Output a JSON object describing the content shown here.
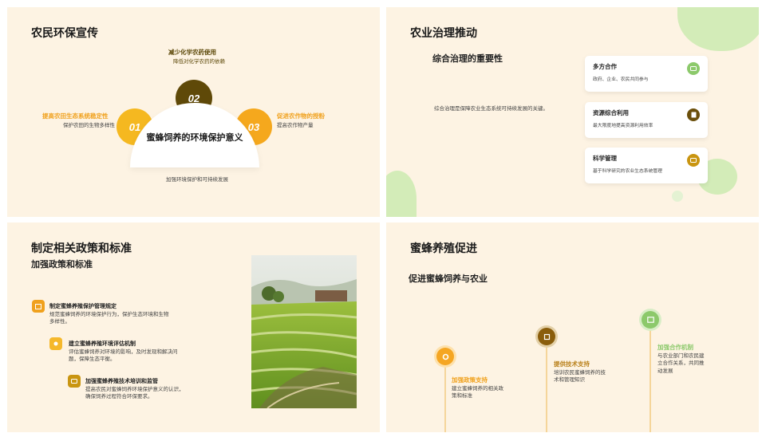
{
  "slide1": {
    "title": "农民环保宣传",
    "center": "蜜蜂饲养的环境保护意义",
    "num1": "01",
    "num2": "02",
    "num3": "03",
    "top_title": "减少化学农药使用",
    "top_desc": "降低对化学农药的依赖",
    "left_title": "提高农田生态系统稳定性",
    "left_desc": "保护农田的生物多样性",
    "right_title": "促进农作物的授粉",
    "right_desc": "提高农作物产量",
    "bottom_desc": "加强环境保护和可持续发展"
  },
  "slide2": {
    "title": "农业治理推动",
    "subtitle": "综合治理的重要性",
    "desc": "综合治理是保障农业生态系统可持续发展的关键。",
    "cards": [
      {
        "title": "多方合作",
        "desc": "政府、企业、农民共同参与",
        "icon": "chat-icon",
        "color": "#8cc96b"
      },
      {
        "title": "资源综合利用",
        "desc": "最大限度地提高资源利用效率",
        "icon": "document-icon",
        "color": "#6b4f0b"
      },
      {
        "title": "科学管理",
        "desc": "基于科学研究的农业生态系统管理",
        "icon": "keyboard-icon",
        "color": "#c99511"
      }
    ]
  },
  "slide3": {
    "title": "制定相关政策和标准",
    "subtitle": "加强政策和标准",
    "items": [
      {
        "title": "制定蜜蜂养殖保护管理规定",
        "desc": "规范蜜蜂饲养的环境保护行为，保护生态环境和生物多样性。",
        "icon": "image-icon",
        "color": "#f0a11d"
      },
      {
        "title": "建立蜜蜂养殖环境评估机制",
        "desc": "评估蜜蜂饲养对环境的影响，及时发现和解决问题，保障生态平衡。",
        "icon": "settings-icon",
        "color": "#f5b82b"
      },
      {
        "title": "加强蜜蜂养殖技术培训和监管",
        "desc": "提高农民对蜜蜂饲养环境保护意义的认识，确保饲养过程符合环保要求。",
        "icon": "chat-icon",
        "color": "#c99511"
      }
    ],
    "photo": "rice-terraces-photo"
  },
  "slide4": {
    "title": "蜜蜂养殖促进",
    "subtitle": "促进蜜蜂饲养与农业",
    "steps": [
      {
        "title": "加强政策支持",
        "desc": "建立蜜蜂饲养的相关政策和标准",
        "icon": "gear-icon",
        "color": "#f5a623",
        "title_color": "#f0a11d"
      },
      {
        "title": "提供技术支持",
        "desc": "培训农民蜜蜂饲养的技术和管理知识",
        "icon": "chip-icon",
        "color": "#8a5d0c",
        "title_color": "#b9801a"
      },
      {
        "title": "加强合作机制",
        "desc": "与农业部门和农民建立合作关系，共同推动发展",
        "icon": "image-icon",
        "color": "#8cc96b",
        "title_color": "#8cc96b"
      }
    ]
  }
}
